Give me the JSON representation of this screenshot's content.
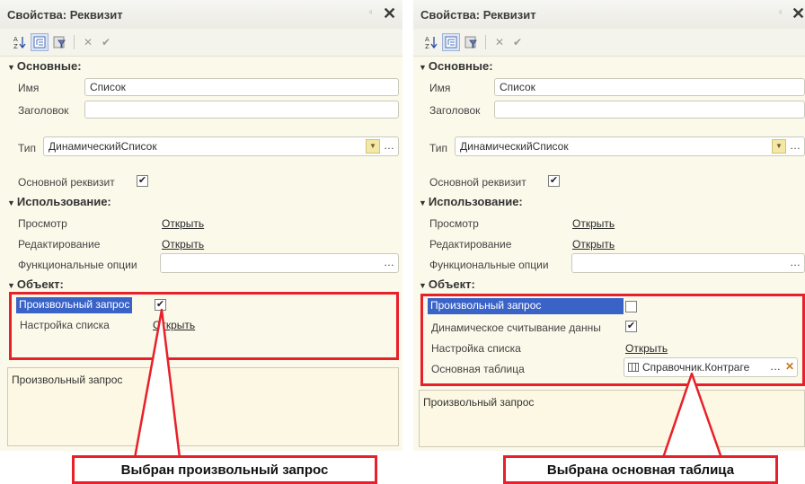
{
  "colors": {
    "highlight": "#3a63c8",
    "annotation_red": "#e8202a",
    "panel_bg": "#fbf9ea"
  },
  "left": {
    "title": "Свойства: Реквизит",
    "pin": "⁴",
    "close": "✕",
    "toolbar": {
      "sort_icon": "sort-az-icon",
      "tree_icon": "tree-view-icon",
      "filter_icon": "filter-icon",
      "cancel": "✕",
      "apply": "✔"
    },
    "sections": {
      "main": "Основные:",
      "usage": "Использование:",
      "object": "Объект:"
    },
    "fields": {
      "name_label": "Имя",
      "name_value": "Список",
      "heading_label": "Заголовок",
      "heading_value": "",
      "type_label": "Тип",
      "type_value": "ДинамическийСписок",
      "main_attr_label": "Основной реквизит",
      "main_attr_checked": "✔",
      "view_label": "Просмотр",
      "view_link": "Открыть",
      "edit_label": "Редактирование",
      "edit_link": "Открыть",
      "func_opts_label": "Функциональные опции",
      "custom_query_label": "Произвольный запрос",
      "custom_query_checked": "✔",
      "list_setup_label": "Настройка списка",
      "list_setup_link": "Открыть"
    },
    "description": "Произвольный запрос",
    "callout": "Выбран произвольный запрос"
  },
  "right": {
    "title": "Свойства: Реквизит",
    "pin": "⁴",
    "close": "✕",
    "toolbar": {
      "sort_icon": "sort-az-icon",
      "tree_icon": "tree-view-icon",
      "filter_icon": "filter-icon",
      "cancel": "✕",
      "apply": "✔"
    },
    "sections": {
      "main": "Основные:",
      "usage": "Использование:",
      "object": "Объект:"
    },
    "fields": {
      "name_label": "Имя",
      "name_value": "Список",
      "heading_label": "Заголовок",
      "heading_value": "",
      "type_label": "Тип",
      "type_value": "ДинамическийСписок",
      "main_attr_label": "Основной реквизит",
      "main_attr_checked": "✔",
      "view_label": "Просмотр",
      "view_link": "Открыть",
      "edit_label": "Редактирование",
      "edit_link": "Открыть",
      "func_opts_label": "Функциональные опции",
      "custom_query_label": "Произвольный запрос",
      "dynamic_read_label": "Динамическое считывание данны",
      "dynamic_read_checked": "✔",
      "list_setup_label": "Настройка списка",
      "list_setup_link": "Открыть",
      "main_table_label": "Основная таблица",
      "main_table_value": "Справочник.Контраге"
    },
    "description": "Произвольный запрос",
    "callout": "Выбрана основная таблица"
  }
}
